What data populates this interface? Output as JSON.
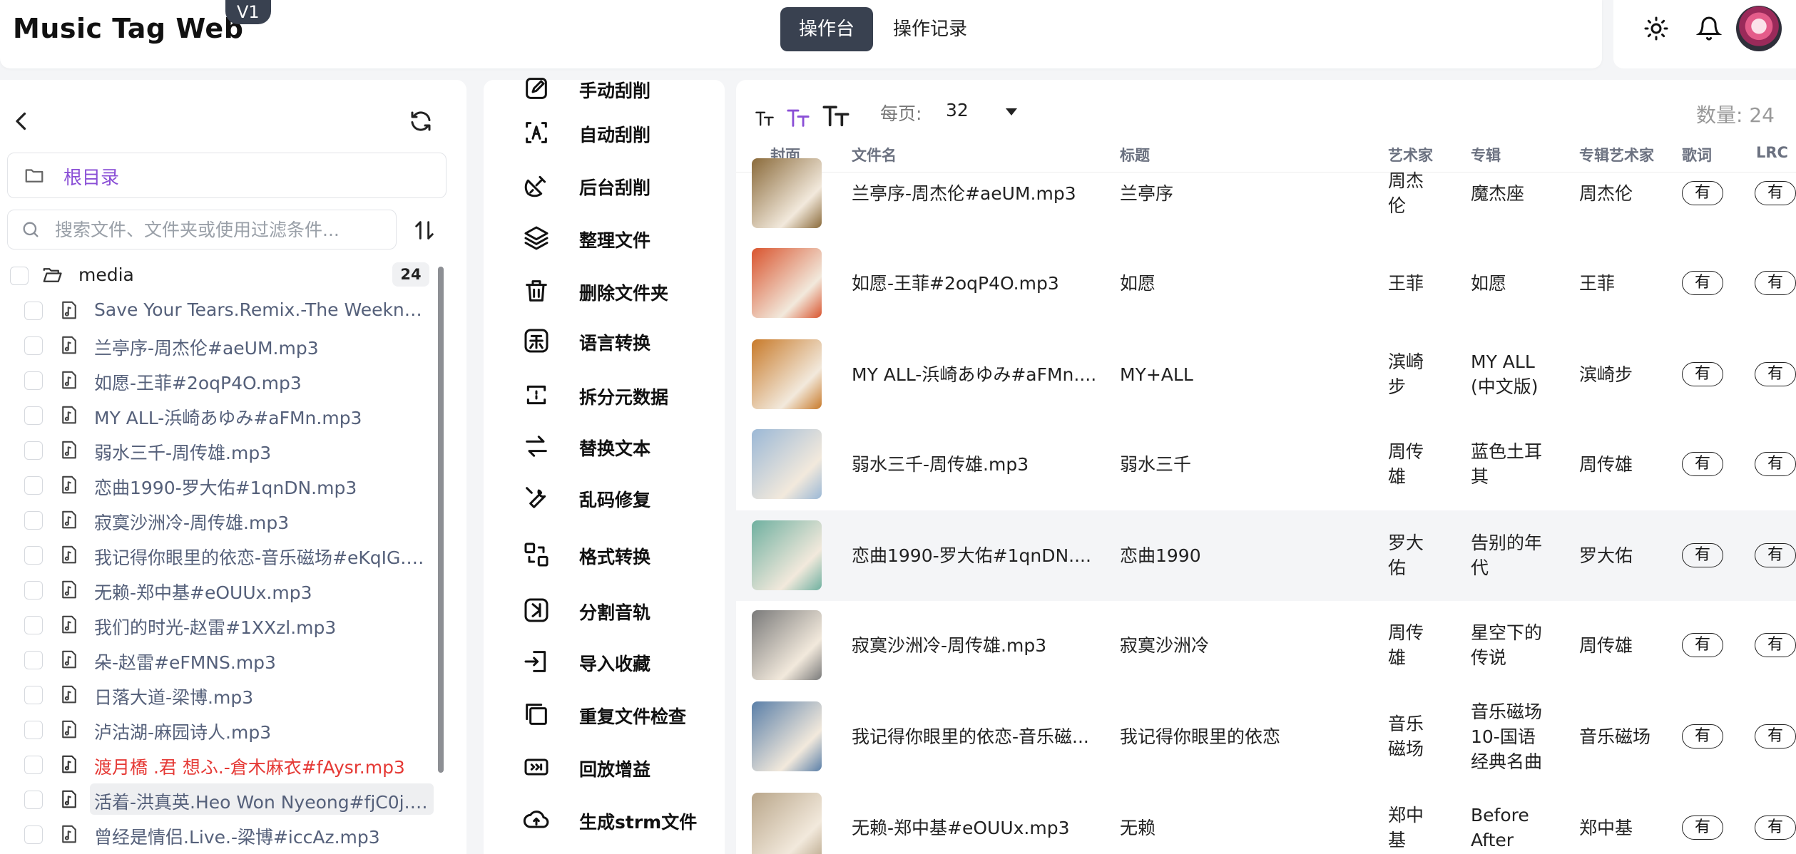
{
  "header": {
    "logo": "Music Tag Web",
    "version": "V1",
    "tabs": [
      {
        "label": "操作台",
        "active": true
      },
      {
        "label": "操作记录",
        "active": false
      }
    ]
  },
  "sidebar": {
    "root_label": "根目录",
    "search_placeholder": "搜索文件、文件夹或使用过滤条件...",
    "folder": {
      "name": "media",
      "count": "24"
    },
    "files": [
      {
        "name": "Save Your Tears.Remix.-The Weeknd.A...",
        "status": "normal"
      },
      {
        "name": "兰亭序-周杰伦#aeUM.mp3",
        "status": "normal"
      },
      {
        "name": "如愿-王菲#2oqP4O.mp3",
        "status": "normal"
      },
      {
        "name": "MY ALL-浜崎あゆみ#aFMn.mp3",
        "status": "normal"
      },
      {
        "name": "弱水三千-周传雄.mp3",
        "status": "normal"
      },
      {
        "name": "恋曲1990-罗大佑#1qnDN.mp3",
        "status": "normal"
      },
      {
        "name": "寂寞沙洲冷-周传雄.mp3",
        "status": "normal"
      },
      {
        "name": "我记得你眼里的依恋-音乐磁场#eKqIG.m...",
        "status": "normal"
      },
      {
        "name": "无赖-郑中基#eOUUx.mp3",
        "status": "normal"
      },
      {
        "name": "我们的时光-赵雷#1XXzl.mp3",
        "status": "normal"
      },
      {
        "name": "朵-赵雷#eFMNS.mp3",
        "status": "normal"
      },
      {
        "name": "日落大道-梁博.mp3",
        "status": "normal"
      },
      {
        "name": "泸沽湖-麻园诗人.mp3",
        "status": "normal"
      },
      {
        "name": "渡月橋 .君 想ふ.-倉木麻衣#fAysr.mp3",
        "status": "red"
      },
      {
        "name": "活着-洪真英.Heo Won Nyeong#fjC0j.m...",
        "status": "highlight"
      },
      {
        "name": "曾经是情侣.Live.-梁博#iccAz.mp3",
        "status": "normal"
      }
    ]
  },
  "toolbar": {
    "items": [
      {
        "label": "手动刮削",
        "icon": "edit-icon"
      },
      {
        "label": "自动刮削",
        "icon": "auto-scrape-icon"
      },
      {
        "label": "后台刮削",
        "icon": "satellite-icon"
      },
      {
        "label": "整理文件",
        "icon": "layers-icon"
      },
      {
        "label": "删除文件夹",
        "icon": "trash-icon"
      },
      {
        "label": "语言转换",
        "icon": "traditional-char-icon"
      },
      {
        "label": "拆分元数据",
        "icon": "split-icon"
      },
      {
        "label": "替换文本",
        "icon": "swap-icon"
      },
      {
        "label": "乱码修复",
        "icon": "wrench-icon"
      },
      {
        "label": "格式转换",
        "icon": "convert-icon"
      },
      {
        "label": "分割音轨",
        "icon": "track-split-icon"
      },
      {
        "label": "导入收藏",
        "icon": "import-icon"
      },
      {
        "label": "重复文件检查",
        "icon": "duplicate-icon"
      },
      {
        "label": "回放增益",
        "icon": "gain-icon"
      },
      {
        "label": "生成strm文件",
        "icon": "cloud-upload-icon"
      }
    ]
  },
  "table": {
    "per_page_label": "每页:",
    "per_page_value": "32",
    "count_label": "数量:  24",
    "columns": [
      "封面",
      "文件名",
      "标题",
      "艺术家",
      "专辑",
      "专辑艺术家",
      "歌词",
      "LRC"
    ],
    "rows": [
      {
        "file": "兰亭序-周杰伦#aeUM.mp3",
        "title": "兰亭序",
        "artist": "周杰\n伦",
        "album": "魔杰座",
        "album_artist": "周杰伦",
        "lyrics": "有",
        "lrc": "有",
        "cover_color": "#8a6a3a"
      },
      {
        "file": "如愿-王菲#2oqP4O.mp3",
        "title": "如愿",
        "artist": "王菲",
        "album": "如愿",
        "album_artist": "王菲",
        "lyrics": "有",
        "lrc": "有",
        "cover_color": "#d9542e"
      },
      {
        "file": "MY ALL-浜崎あゆみ#aFMn....",
        "title": "MY+ALL",
        "artist": "滨崎\n步",
        "album": "MY ALL\n(中文版)",
        "album_artist": "滨崎步",
        "lyrics": "有",
        "lrc": "有",
        "cover_color": "#c87a2a"
      },
      {
        "file": "弱水三千-周传雄.mp3",
        "title": "弱水三千",
        "artist": "周传\n雄",
        "album": "蓝色土耳\n其",
        "album_artist": "周传雄",
        "lyrics": "有",
        "lrc": "有",
        "cover_color": "#9bb8d6"
      },
      {
        "file": "恋曲1990-罗大佑#1qnDN....",
        "title": "恋曲1990",
        "artist": "罗大\n佑",
        "album": "告别的年\n代",
        "album_artist": "罗大佑",
        "lyrics": "有",
        "lrc": "有",
        "cover_color": "#6fb0a0"
      },
      {
        "file": "寂寞沙洲冷-周传雄.mp3",
        "title": "寂寞沙洲冷",
        "artist": "周传\n雄",
        "album": "星空下的\n传说",
        "album_artist": "周传雄",
        "lyrics": "有",
        "lrc": "有",
        "cover_color": "#7a7a7a"
      },
      {
        "file": "我记得你眼里的依恋-音乐磁...",
        "title": "我记得你眼里的依恋",
        "artist": "音乐\n磁场",
        "album": "音乐磁场\n10-国语\n经典名曲",
        "album_artist": "音乐磁场",
        "lyrics": "有",
        "lrc": "有",
        "cover_color": "#5a7fa8"
      },
      {
        "file": "无赖-郑中基#eOUUx.mp3",
        "title": "无赖",
        "artist": "郑中\n基",
        "album": "Before\nAfter",
        "album_artist": "郑中基",
        "lyrics": "有",
        "lrc": "有",
        "cover_color": "#b9a68a"
      }
    ]
  },
  "colors": {
    "accent_purple": "#8a4fd6",
    "dark_tab": "#394150",
    "error_red": "#e53935"
  }
}
